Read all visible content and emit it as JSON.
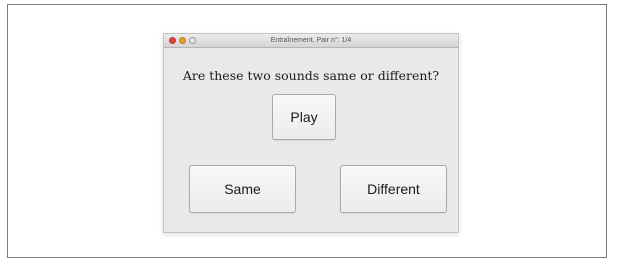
{
  "window": {
    "title": "Entraînement, Pair n°: 1/4",
    "controls": {
      "close": "close-button",
      "minimize": "minimize-button",
      "zoom": "zoom-button"
    }
  },
  "prompt": {
    "question": "Are these two sounds same or different?"
  },
  "buttons": {
    "play_label": "Play",
    "same_label": "Same",
    "different_label": "Different"
  },
  "colors": {
    "close": "#e0443e",
    "minimize": "#e6a229",
    "window_bg": "#e9e9e9"
  }
}
